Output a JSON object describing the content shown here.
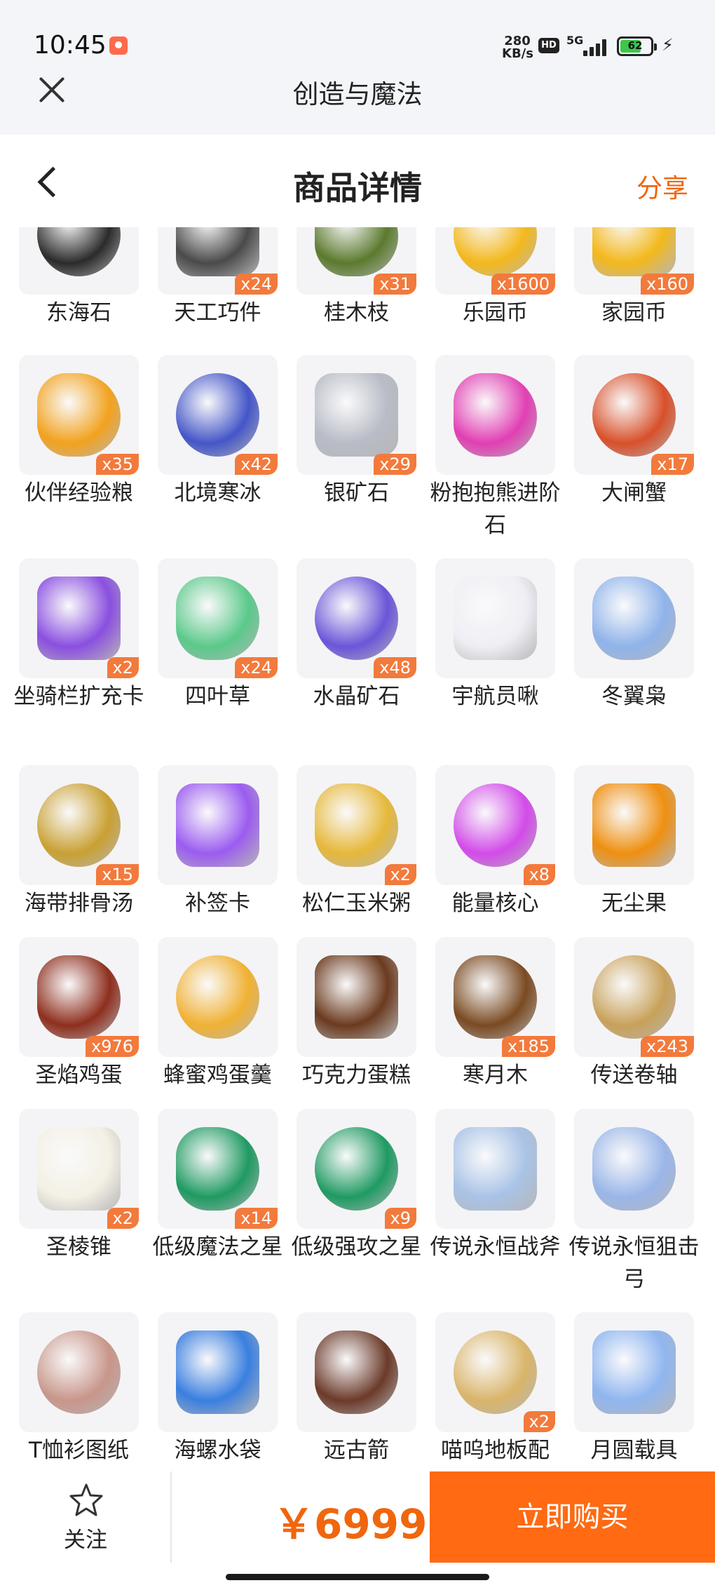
{
  "status_bar": {
    "time": "10:45",
    "net_speed_value": "280",
    "net_speed_unit": "KB/s",
    "hd": "HD",
    "network": "5G",
    "battery": "62"
  },
  "app": {
    "title": "创造与魔法"
  },
  "header": {
    "title": "商品详情",
    "share_label": "分享"
  },
  "items": [
    {
      "name": "东海石",
      "qty": "",
      "icon": "black-rock-icon",
      "color": "#2b2b2b"
    },
    {
      "name": "天工巧件",
      "qty": "x24",
      "icon": "gear-part-icon",
      "color": "#4a4a4a"
    },
    {
      "name": "桂木枝",
      "qty": "x31",
      "icon": "branch-icon",
      "color": "#5b7a2e"
    },
    {
      "name": "乐园币",
      "qty": "x1600",
      "icon": "gold-coin-icon",
      "color": "#f3b81c"
    },
    {
      "name": "家园币",
      "qty": "x160",
      "icon": "gold-coin-icon",
      "color": "#f3b81c"
    },
    {
      "name": "伙伴经验粮",
      "qty": "x35",
      "icon": "food-bag-icon",
      "color": "#f2a21e"
    },
    {
      "name": "北境寒冰",
      "qty": "x42",
      "icon": "ice-crystal-icon",
      "color": "#4456c8"
    },
    {
      "name": "银矿石",
      "qty": "x29",
      "icon": "silver-ore-icon",
      "color": "#b9bcc6"
    },
    {
      "name": "粉抱抱熊进阶石",
      "qty": "",
      "icon": "pink-gem-icon",
      "color": "#e13fb3"
    },
    {
      "name": "大闸蟹",
      "qty": "x17",
      "icon": "crab-icon",
      "color": "#d8502a"
    },
    {
      "name": "坐骑栏扩充卡",
      "qty": "x2",
      "icon": "crown-card-icon",
      "color": "#8a4fe0"
    },
    {
      "name": "四叶草",
      "qty": "x24",
      "icon": "clover-icon",
      "color": "#5bc98a"
    },
    {
      "name": "水晶矿石",
      "qty": "x48",
      "icon": "crystal-ore-icon",
      "color": "#6a56d8"
    },
    {
      "name": "宇航员啾",
      "qty": "",
      "icon": "astronaut-pet-icon",
      "color": "#eeeef4"
    },
    {
      "name": "冬翼枭",
      "qty": "",
      "icon": "ice-dragon-icon",
      "color": "#8fb3ea"
    },
    {
      "name": "海带排骨汤",
      "qty": "x15",
      "icon": "soup-bowl-icon",
      "color": "#c9a032"
    },
    {
      "name": "补签卡",
      "qty": "",
      "icon": "ticket-icon",
      "color": "#9b5cf0"
    },
    {
      "name": "松仁玉米粥",
      "qty": "x2",
      "icon": "porridge-icon",
      "color": "#e6b83a"
    },
    {
      "name": "能量核心",
      "qty": "x8",
      "icon": "energy-gem-icon",
      "color": "#d24be8"
    },
    {
      "name": "无尘果",
      "qty": "",
      "icon": "fruit-icon",
      "color": "#ef8f10"
    },
    {
      "name": "圣焰鸡蛋",
      "qty": "x976",
      "icon": "egg-icon",
      "color": "#8e2f1e"
    },
    {
      "name": "蜂蜜鸡蛋羹",
      "qty": "",
      "icon": "custard-icon",
      "color": "#f0b133"
    },
    {
      "name": "巧克力蛋糕",
      "qty": "",
      "icon": "cupcake-icon",
      "color": "#6b3a1e"
    },
    {
      "name": "寒月木",
      "qty": "x185",
      "icon": "log-icon",
      "color": "#7a4a22"
    },
    {
      "name": "传送卷轴",
      "qty": "x243",
      "icon": "scroll-icon",
      "color": "#c8a15a"
    },
    {
      "name": "圣棱锥",
      "qty": "x2",
      "icon": "pyramid-icon",
      "color": "#f3f0e4"
    },
    {
      "name": "低级魔法之星",
      "qty": "x14",
      "icon": "green-star-gem-icon",
      "color": "#1f9a62"
    },
    {
      "name": "低级强攻之星",
      "qty": "x9",
      "icon": "green-star-gem-icon",
      "color": "#1f9a62"
    },
    {
      "name": "传说永恒战斧",
      "qty": "",
      "icon": "axe-icon",
      "color": "#a9c3e6"
    },
    {
      "name": "传说永恒狙击弓",
      "qty": "",
      "icon": "bow-icon",
      "color": "#9ab6e8"
    },
    {
      "name": "T恤衫图纸",
      "qty": "",
      "icon": "blueprint-icon",
      "color": "#c8968a"
    },
    {
      "name": "海螺水袋",
      "qty": "",
      "icon": "shell-bag-icon",
      "color": "#3a7fe0"
    },
    {
      "name": "远古箭",
      "qty": "",
      "icon": "arrow-icon",
      "color": "#6b3a2a"
    },
    {
      "name": "喵呜地板配",
      "qty": "x2",
      "icon": "floor-plan-icon",
      "color": "#d9b56a"
    },
    {
      "name": "月圆载具",
      "qty": "",
      "icon": "moon-orb-icon",
      "color": "#8fb6f0"
    }
  ],
  "bottom": {
    "follow_label": "关注",
    "price": "￥6999",
    "buy_label": "立即购买"
  },
  "colors": {
    "accent": "#ff6a13",
    "price": "#f0660e",
    "qty_badge": "#f27a3c"
  }
}
